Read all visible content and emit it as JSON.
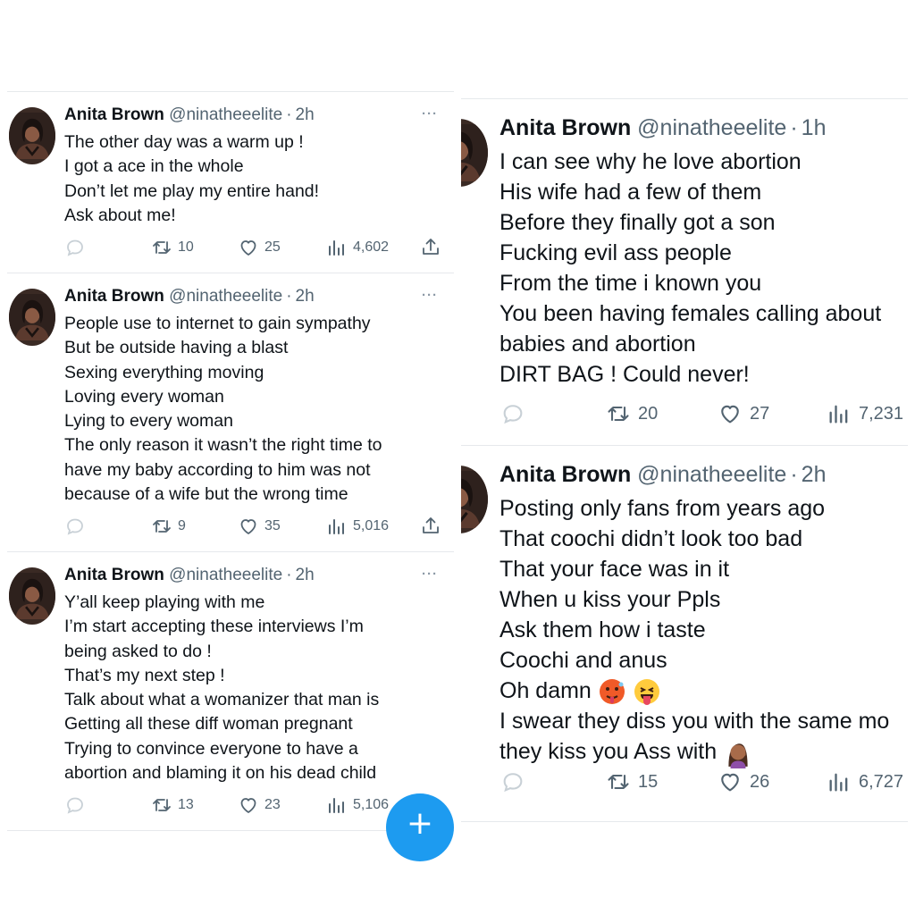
{
  "left_tweets": [
    {
      "name": "Anita Brown",
      "handle": "@ninatheeelite",
      "separator": "·",
      "time": "2h",
      "more": "···",
      "lines": [
        "The other day was a warm up !",
        "I got a ace in the whole",
        "Don’t let me play my entire hand!",
        "Ask about me!"
      ],
      "retweets": "10",
      "likes": "25",
      "views": "4,602"
    },
    {
      "name": "Anita Brown",
      "handle": "@ninatheeelite",
      "separator": "·",
      "time": "2h",
      "more": "···",
      "lines": [
        "People use to internet to gain sympathy",
        "But be outside having a blast",
        "Sexing everything moving",
        "Loving every woman",
        "Lying to every woman",
        "The only reason it wasn’t the right time to",
        "have my baby according to him was not",
        "because of a wife but the wrong time"
      ],
      "retweets": "9",
      "likes": "35",
      "views": "5,016"
    },
    {
      "name": "Anita Brown",
      "handle": "@ninatheeelite",
      "separator": "·",
      "time": "2h",
      "more": "···",
      "lines": [
        "Y’all keep playing with me",
        "I’m start accepting these interviews I’m",
        "being asked to do !",
        "That’s my next step !",
        "Talk about what a womanizer that man is",
        "Getting all these diff woman pregnant",
        "Trying to convince everyone to have a",
        "abortion and blaming it on his dead child"
      ],
      "retweets": "13",
      "likes": "23",
      "views": "5,106"
    }
  ],
  "right_tweets": [
    {
      "name": "Anita Brown",
      "handle": "@ninatheeelite",
      "separator": "·",
      "time": "1h",
      "lines": [
        "I can see why he love abortion",
        "His wife had a few of them",
        "Before they finally got a son",
        "Fucking evil ass people",
        "From the time i known you",
        "You been having females calling about",
        "babies and abortion",
        "DIRT BAG ! Could never!"
      ],
      "retweets": "20",
      "likes": "27",
      "views": "7,231"
    },
    {
      "name": "Anita Brown",
      "handle": "@ninatheeelite",
      "separator": "·",
      "time": "2h",
      "lines": [
        "Posting only fans from years ago",
        "That coochi didn’t look too bad",
        "That your face was in it",
        "When u kiss your Ppls",
        "Ask them how i taste",
        "Coochi and anus",
        "Oh damn",
        "I swear they diss you with the same mo",
        "they kiss you Ass with"
      ],
      "retweets": "15",
      "likes": "26",
      "views": "6,727"
    }
  ],
  "compose_button": {
    "label": "+"
  },
  "colors": {
    "text": "#0f1419",
    "secondary": "#536471",
    "divider": "#e6e9ec",
    "accent": "#1d9bf0"
  },
  "icons": {
    "reply": "reply-icon",
    "retweet": "retweet-icon",
    "like": "heart-icon",
    "views": "views-icon",
    "share": "share-icon",
    "more": "more-icon",
    "compose": "plus-icon"
  }
}
